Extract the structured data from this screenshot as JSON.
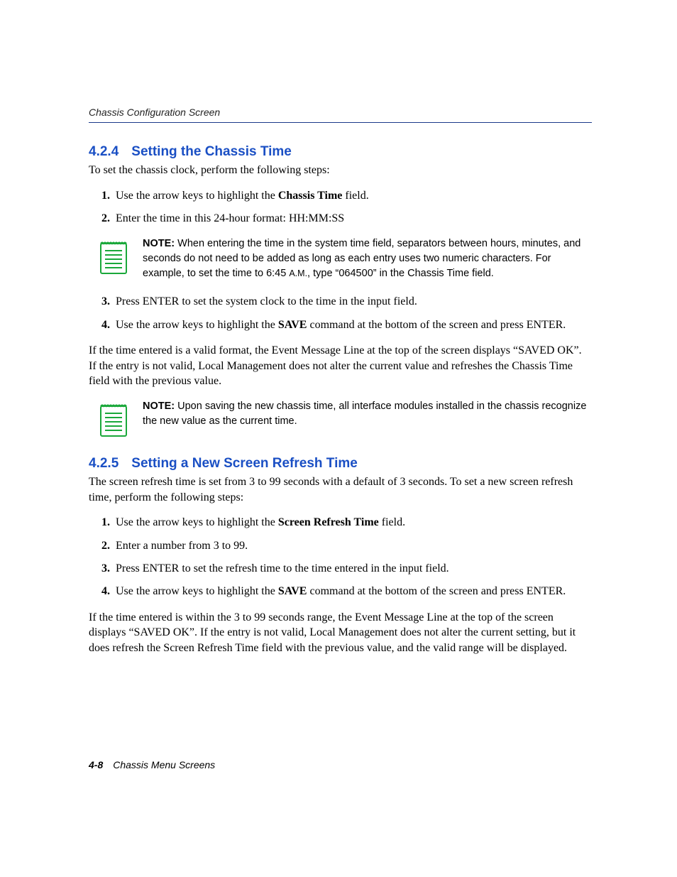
{
  "header": {
    "running": "Chassis Configuration Screen"
  },
  "sections": {
    "s424": {
      "num": "4.2.4",
      "title": "Setting the Chassis Time",
      "intro": "To set the chassis clock, perform the following steps:",
      "steps": {
        "s1a": "Use the arrow keys to highlight the ",
        "s1b": "Chassis Time",
        "s1c": " field.",
        "s2": "Enter the time in this 24-hour format: HH:MM:SS",
        "s3": "Press ENTER to set the system clock to the time in the input field.",
        "s4a": "Use the arrow keys to highlight the ",
        "s4b": "SAVE",
        "s4c": " command at the bottom of the screen and press ENTER."
      },
      "note1": {
        "label": "NOTE:",
        "body_a": "  When entering the time in the system time field, separators between hours, minutes, and seconds do not need to be added as long as each entry uses two numeric characters. For example, to set the time to 6:45 ",
        "body_am": "A.M.",
        "body_b": ", type “064500” in the Chassis Time field."
      },
      "para_after": "If the time entered is a valid format, the Event Message Line at the top of the screen displays “SAVED OK”. If the entry is not valid, Local Management does not alter the current value and refreshes the Chassis Time field with the previous value.",
      "note2": {
        "label": "NOTE:",
        "body": "  Upon saving the new chassis time, all interface modules installed in the chassis recognize the new value as the current time."
      }
    },
    "s425": {
      "num": "4.2.5",
      "title": "Setting a New Screen Refresh Time",
      "intro": "The screen refresh time is set from 3 to 99 seconds with a default of 3 seconds. To set a new screen refresh time, perform the following steps:",
      "steps": {
        "s1a": "Use the arrow keys to highlight the ",
        "s1b": "Screen Refresh Time",
        "s1c": " field.",
        "s2": "Enter a number from 3 to 99.",
        "s3": "Press ENTER to set the refresh time to the time entered in the input field.",
        "s4a": "Use the arrow keys to highlight the ",
        "s4b": "SAVE",
        "s4c": " command at the bottom of the screen and press ENTER."
      },
      "para_after": "If the time entered is within the 3 to 99 seconds range, the Event Message Line at the top of the screen displays “SAVED OK”. If the entry is not valid, Local Management does not alter the current setting, but it does refresh the Screen Refresh Time field with the previous value, and the valid range will be displayed."
    }
  },
  "footer": {
    "pagenum": "4-8",
    "section": "Chassis Menu Screens"
  }
}
